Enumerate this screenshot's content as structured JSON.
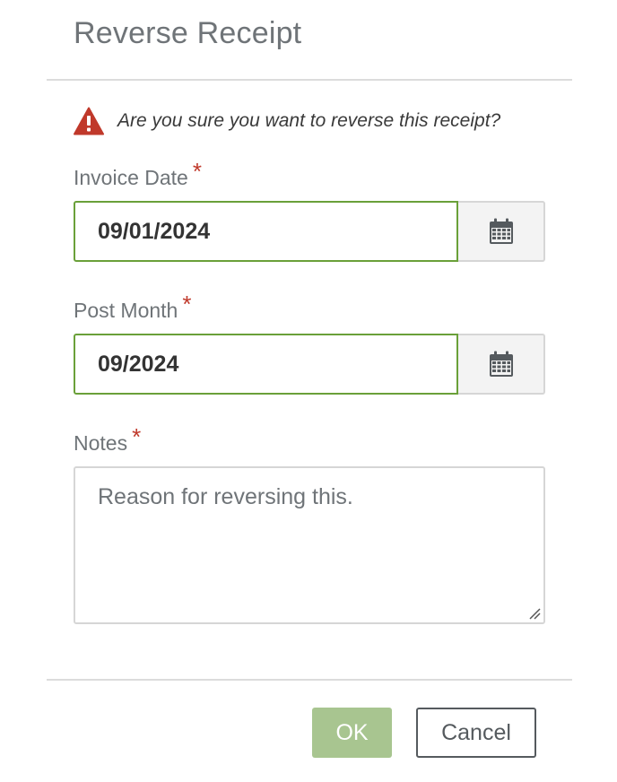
{
  "dialog": {
    "title": "Reverse Receipt",
    "warning_message": "Are you sure you want to reverse this receipt?",
    "required_marker": "*"
  },
  "fields": {
    "invoice_date": {
      "label": "Invoice Date",
      "value": "09/01/2024"
    },
    "post_month": {
      "label": "Post Month",
      "value": "09/2024"
    },
    "notes": {
      "label": "Notes",
      "value": "Reason for reversing this."
    }
  },
  "buttons": {
    "ok_label": "OK",
    "cancel_label": "Cancel"
  },
  "colors": {
    "accent_green": "#6aa039",
    "ok_button_bg": "#a8c590",
    "warning_red": "#c0392b",
    "required_red": "#c0392b"
  },
  "icons": {
    "warning": "warning-triangle-icon",
    "calendar": "calendar-icon",
    "resize": "resize-grip-icon"
  }
}
